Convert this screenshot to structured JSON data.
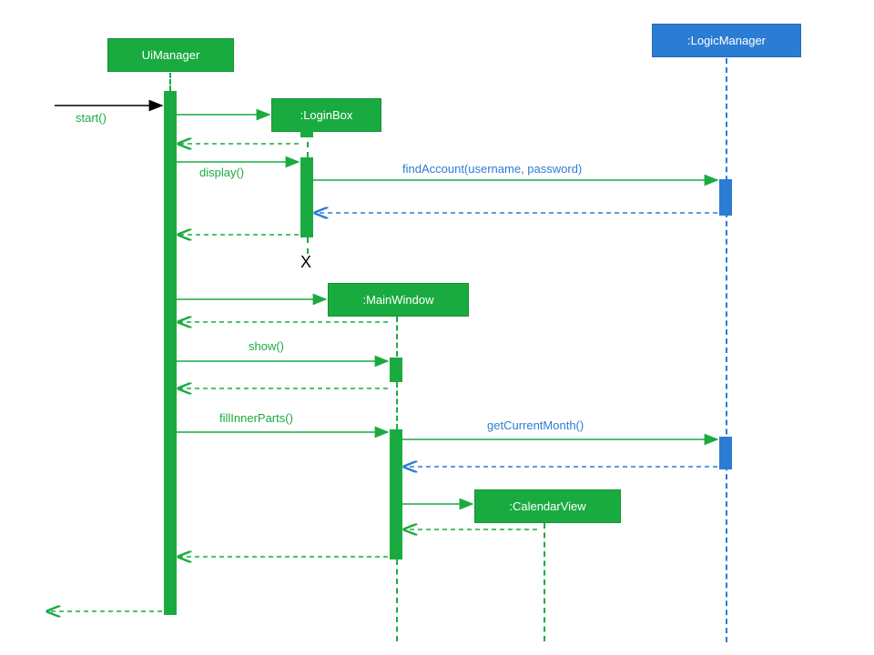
{
  "diagram": {
    "type": "uml-sequence-diagram",
    "participants": {
      "uiManager": "UiManager",
      "loginBox": ":LoginBox",
      "logicManager": ":LogicManager",
      "mainWindow": ":MainWindow",
      "calendarView": ":CalendarView"
    },
    "messages": {
      "start": "start()",
      "display": "display()",
      "findAccount": "findAccount(username, password)",
      "show": "show()",
      "fillInnerParts": "fillInnerParts()",
      "getCurrentMonth": "getCurrentMonth()"
    },
    "destructionMarker": "X",
    "colors": {
      "green": "#1aab40",
      "blue": "#2b7cd3"
    }
  }
}
